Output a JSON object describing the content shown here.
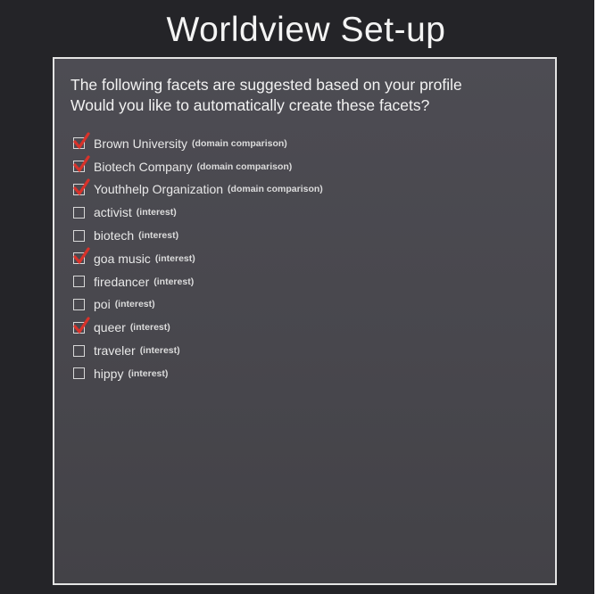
{
  "window": {
    "title": "Worldview Set-up"
  },
  "intro": {
    "line1": "The following facets are suggested based on your profile",
    "line2": "Would you like to automatically create these facets?"
  },
  "colors": {
    "background": "#242428",
    "panel": "#4a494f",
    "check_mark": "#d9322a",
    "text": "#f2f2f2"
  },
  "facets": [
    {
      "name": "Brown University",
      "type": "(domain comparison)",
      "checked": true
    },
    {
      "name": "Biotech Company",
      "type": "(domain comparison)",
      "checked": true
    },
    {
      "name": "Youthhelp Organization",
      "type": "(domain comparison)",
      "checked": true
    },
    {
      "name": "activist",
      "type": "(interest)",
      "checked": false
    },
    {
      "name": "biotech",
      "type": "(interest)",
      "checked": false
    },
    {
      "name": "goa music",
      "type": "(interest)",
      "checked": true
    },
    {
      "name": "firedancer",
      "type": "(interest)",
      "checked": false
    },
    {
      "name": "poi",
      "type": "(interest)",
      "checked": false
    },
    {
      "name": "queer",
      "type": "(interest)",
      "checked": true
    },
    {
      "name": "traveler",
      "type": "(interest)",
      "checked": false
    },
    {
      "name": "hippy",
      "type": "(interest)",
      "checked": false
    }
  ]
}
